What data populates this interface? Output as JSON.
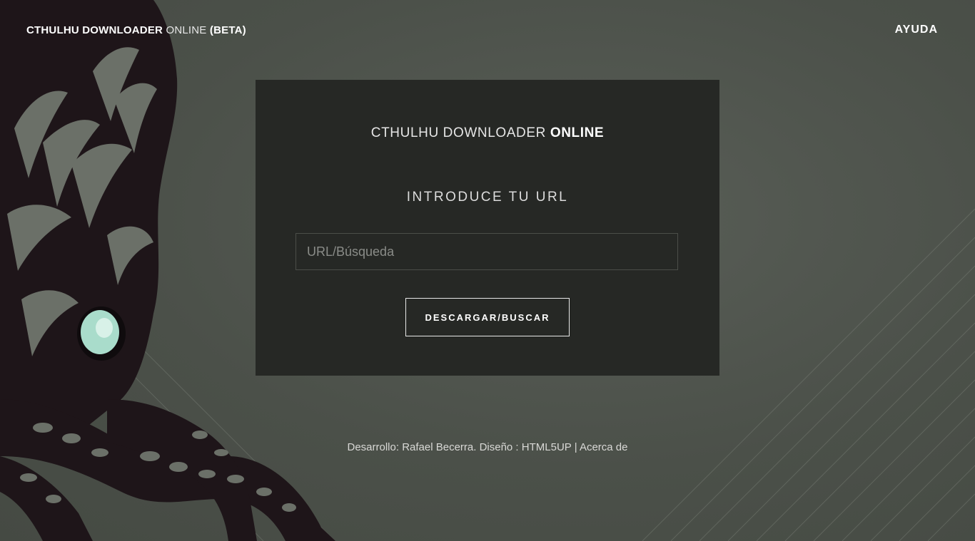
{
  "header": {
    "brand_bold": "CTHULHU DOWNLOADER",
    "brand_light": "ONLINE",
    "brand_beta": "(BETA)",
    "help_label": "AYUDA"
  },
  "panel": {
    "title_light": "CTHULHU DOWNLOADER",
    "title_bold": "ONLINE",
    "subtitle": "INTRODUCE TU URL",
    "input_placeholder": "URL/Búsqueda",
    "input_value": "",
    "submit_label": "DESCARGAR/BUSCAR"
  },
  "footer": {
    "dev_text": "Desarrollo: Rafael Becerra. Diseño :",
    "design_link": "HTML5UP",
    "separator": "|",
    "about_link": "Acerca de"
  },
  "colors": {
    "background": "#4d524b",
    "panel": "#262825",
    "art_dark": "#1e1519",
    "eye_glow": "#a9dccb"
  },
  "icons": {
    "background_art": "cthulhu-illustration"
  }
}
